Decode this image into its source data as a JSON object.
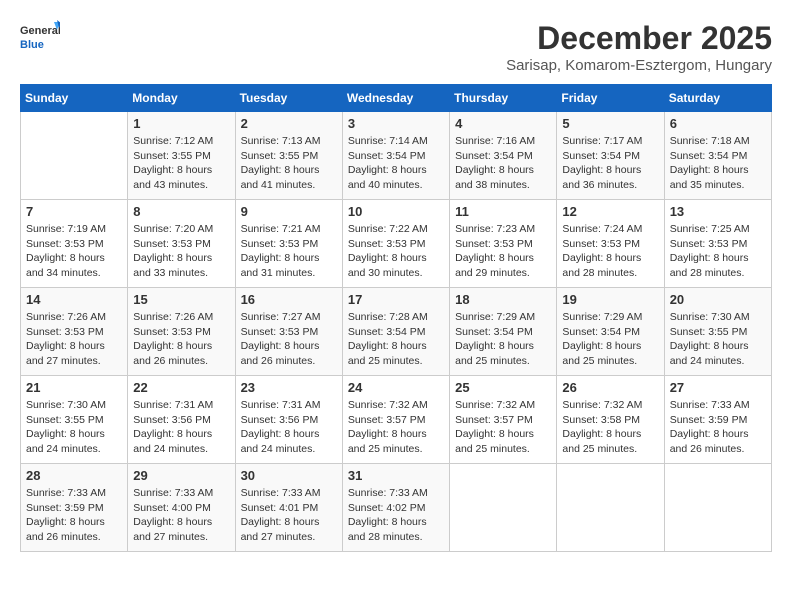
{
  "logo": {
    "line1": "General",
    "line2": "Blue"
  },
  "title": "December 2025",
  "subtitle": "Sarisap, Komarom-Esztergom, Hungary",
  "days_of_week": [
    "Sunday",
    "Monday",
    "Tuesday",
    "Wednesday",
    "Thursday",
    "Friday",
    "Saturday"
  ],
  "weeks": [
    [
      {
        "day": "",
        "info": ""
      },
      {
        "day": "1",
        "info": "Sunrise: 7:12 AM\nSunset: 3:55 PM\nDaylight: 8 hours\nand 43 minutes."
      },
      {
        "day": "2",
        "info": "Sunrise: 7:13 AM\nSunset: 3:55 PM\nDaylight: 8 hours\nand 41 minutes."
      },
      {
        "day": "3",
        "info": "Sunrise: 7:14 AM\nSunset: 3:54 PM\nDaylight: 8 hours\nand 40 minutes."
      },
      {
        "day": "4",
        "info": "Sunrise: 7:16 AM\nSunset: 3:54 PM\nDaylight: 8 hours\nand 38 minutes."
      },
      {
        "day": "5",
        "info": "Sunrise: 7:17 AM\nSunset: 3:54 PM\nDaylight: 8 hours\nand 36 minutes."
      },
      {
        "day": "6",
        "info": "Sunrise: 7:18 AM\nSunset: 3:54 PM\nDaylight: 8 hours\nand 35 minutes."
      }
    ],
    [
      {
        "day": "7",
        "info": "Sunrise: 7:19 AM\nSunset: 3:53 PM\nDaylight: 8 hours\nand 34 minutes."
      },
      {
        "day": "8",
        "info": "Sunrise: 7:20 AM\nSunset: 3:53 PM\nDaylight: 8 hours\nand 33 minutes."
      },
      {
        "day": "9",
        "info": "Sunrise: 7:21 AM\nSunset: 3:53 PM\nDaylight: 8 hours\nand 31 minutes."
      },
      {
        "day": "10",
        "info": "Sunrise: 7:22 AM\nSunset: 3:53 PM\nDaylight: 8 hours\nand 30 minutes."
      },
      {
        "day": "11",
        "info": "Sunrise: 7:23 AM\nSunset: 3:53 PM\nDaylight: 8 hours\nand 29 minutes."
      },
      {
        "day": "12",
        "info": "Sunrise: 7:24 AM\nSunset: 3:53 PM\nDaylight: 8 hours\nand 28 minutes."
      },
      {
        "day": "13",
        "info": "Sunrise: 7:25 AM\nSunset: 3:53 PM\nDaylight: 8 hours\nand 28 minutes."
      }
    ],
    [
      {
        "day": "14",
        "info": "Sunrise: 7:26 AM\nSunset: 3:53 PM\nDaylight: 8 hours\nand 27 minutes."
      },
      {
        "day": "15",
        "info": "Sunrise: 7:26 AM\nSunset: 3:53 PM\nDaylight: 8 hours\nand 26 minutes."
      },
      {
        "day": "16",
        "info": "Sunrise: 7:27 AM\nSunset: 3:53 PM\nDaylight: 8 hours\nand 26 minutes."
      },
      {
        "day": "17",
        "info": "Sunrise: 7:28 AM\nSunset: 3:54 PM\nDaylight: 8 hours\nand 25 minutes."
      },
      {
        "day": "18",
        "info": "Sunrise: 7:29 AM\nSunset: 3:54 PM\nDaylight: 8 hours\nand 25 minutes."
      },
      {
        "day": "19",
        "info": "Sunrise: 7:29 AM\nSunset: 3:54 PM\nDaylight: 8 hours\nand 25 minutes."
      },
      {
        "day": "20",
        "info": "Sunrise: 7:30 AM\nSunset: 3:55 PM\nDaylight: 8 hours\nand 24 minutes."
      }
    ],
    [
      {
        "day": "21",
        "info": "Sunrise: 7:30 AM\nSunset: 3:55 PM\nDaylight: 8 hours\nand 24 minutes."
      },
      {
        "day": "22",
        "info": "Sunrise: 7:31 AM\nSunset: 3:56 PM\nDaylight: 8 hours\nand 24 minutes."
      },
      {
        "day": "23",
        "info": "Sunrise: 7:31 AM\nSunset: 3:56 PM\nDaylight: 8 hours\nand 24 minutes."
      },
      {
        "day": "24",
        "info": "Sunrise: 7:32 AM\nSunset: 3:57 PM\nDaylight: 8 hours\nand 25 minutes."
      },
      {
        "day": "25",
        "info": "Sunrise: 7:32 AM\nSunset: 3:57 PM\nDaylight: 8 hours\nand 25 minutes."
      },
      {
        "day": "26",
        "info": "Sunrise: 7:32 AM\nSunset: 3:58 PM\nDaylight: 8 hours\nand 25 minutes."
      },
      {
        "day": "27",
        "info": "Sunrise: 7:33 AM\nSunset: 3:59 PM\nDaylight: 8 hours\nand 26 minutes."
      }
    ],
    [
      {
        "day": "28",
        "info": "Sunrise: 7:33 AM\nSunset: 3:59 PM\nDaylight: 8 hours\nand 26 minutes."
      },
      {
        "day": "29",
        "info": "Sunrise: 7:33 AM\nSunset: 4:00 PM\nDaylight: 8 hours\nand 27 minutes."
      },
      {
        "day": "30",
        "info": "Sunrise: 7:33 AM\nSunset: 4:01 PM\nDaylight: 8 hours\nand 27 minutes."
      },
      {
        "day": "31",
        "info": "Sunrise: 7:33 AM\nSunset: 4:02 PM\nDaylight: 8 hours\nand 28 minutes."
      },
      {
        "day": "",
        "info": ""
      },
      {
        "day": "",
        "info": ""
      },
      {
        "day": "",
        "info": ""
      }
    ]
  ]
}
